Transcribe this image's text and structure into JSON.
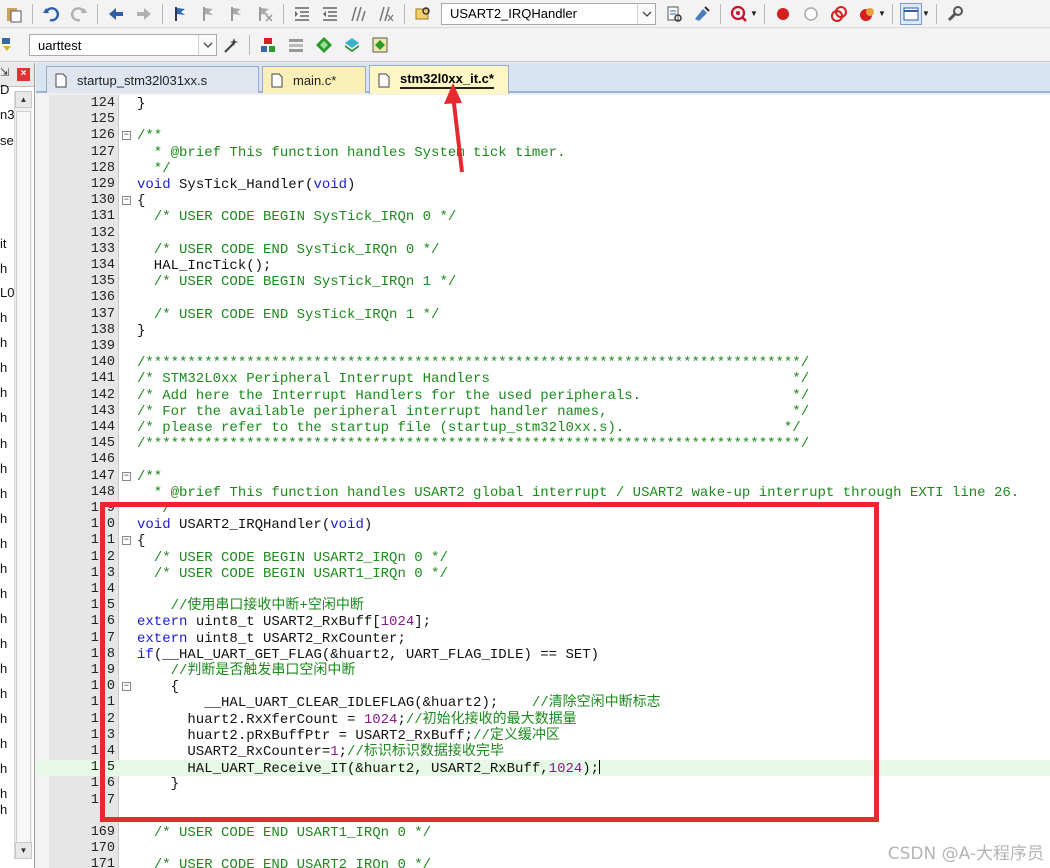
{
  "toolbar_top": {
    "function_combo_value": "USART2_IRQHandler"
  },
  "toolbar_build": {
    "target_combo_value": "uarttest"
  },
  "tabs": [
    {
      "label": "startup_stm32l031xx.s",
      "state": "inactive"
    },
    {
      "label": "main.c*",
      "state": "modified"
    },
    {
      "label": "stm32l0xx_it.c*",
      "state": "active"
    }
  ],
  "left_panel_fragments": [
    "D",
    "n3",
    "se",
    "it",
    "h",
    "L0",
    "h",
    "h",
    "h",
    "h",
    "h",
    "h",
    "h",
    "h",
    "h",
    "h",
    "h",
    "h",
    "h",
    "h",
    "h",
    "h",
    "h",
    "h",
    "h",
    "h",
    "h"
  ],
  "code_lines": [
    {
      "num": "124",
      "fold": "",
      "html": "}"
    },
    {
      "num": "125",
      "fold": "",
      "html": ""
    },
    {
      "num": "126",
      "fold": "-",
      "html": "<span class=\"cm\">/**</span>"
    },
    {
      "num": "127",
      "fold": "",
      "html": "<span class=\"cm\">  * @brief This function handles System tick timer.</span>"
    },
    {
      "num": "128",
      "fold": "",
      "html": "<span class=\"cm\">  */</span>"
    },
    {
      "num": "129",
      "fold": "",
      "html": "<span class=\"kw\">void</span> SysTick_Handler(<span class=\"kw\">void</span>)"
    },
    {
      "num": "130",
      "fold": "-",
      "html": "{"
    },
    {
      "num": "131",
      "fold": "",
      "html": "  <span class=\"cm\">/* USER CODE BEGIN SysTick_IRQn 0 */</span>"
    },
    {
      "num": "132",
      "fold": "",
      "html": ""
    },
    {
      "num": "133",
      "fold": "",
      "html": "  <span class=\"cm\">/* USER CODE END SysTick_IRQn 0 */</span>"
    },
    {
      "num": "134",
      "fold": "",
      "html": "  HAL_IncTick();"
    },
    {
      "num": "135",
      "fold": "",
      "html": "  <span class=\"cm\">/* USER CODE BEGIN SysTick_IRQn 1 */</span>"
    },
    {
      "num": "136",
      "fold": "",
      "html": ""
    },
    {
      "num": "137",
      "fold": "",
      "html": "  <span class=\"cm\">/* USER CODE END SysTick_IRQn 1 */</span>"
    },
    {
      "num": "138",
      "fold": "",
      "html": "}"
    },
    {
      "num": "139",
      "fold": "",
      "html": ""
    },
    {
      "num": "140",
      "fold": "",
      "html": "<span class=\"cm\">/******************************************************************************/</span>"
    },
    {
      "num": "141",
      "fold": "",
      "html": "<span class=\"cm\">/* STM32L0xx Peripheral Interrupt Handlers                                    */</span>"
    },
    {
      "num": "142",
      "fold": "",
      "html": "<span class=\"cm\">/* Add here the Interrupt Handlers for the used peripherals.                  */</span>"
    },
    {
      "num": "143",
      "fold": "",
      "html": "<span class=\"cm\">/* For the available peripheral interrupt handler names,                      */</span>"
    },
    {
      "num": "144",
      "fold": "",
      "html": "<span class=\"cm\">/* please refer to the startup file (startup_stm32l0xx.s).                   */</span>"
    },
    {
      "num": "145",
      "fold": "",
      "html": "<span class=\"cm\">/******************************************************************************/</span>"
    },
    {
      "num": "146",
      "fold": "",
      "html": ""
    },
    {
      "num": "147",
      "fold": "-",
      "html": "<span class=\"cm\">/**</span>"
    },
    {
      "num": "148",
      "fold": "",
      "html": "<span class=\"cm\">  * @brief This function handles USART2 global interrupt / USART2 wake-up interrupt through EXTI line 26.</span>"
    },
    {
      "num": "1  9",
      "fold": "",
      "html": "<span class=\"cm\">  */</span>"
    },
    {
      "num": "1  0",
      "fold": "",
      "html": "<span class=\"kw\">void</span> USART2_IRQHandler(<span class=\"kw\">void</span>)"
    },
    {
      "num": "1  1",
      "fold": "-",
      "html": "{"
    },
    {
      "num": "1  2",
      "fold": "",
      "html": "  <span class=\"cm\">/* USER CODE BEGIN USART2_IRQn 0 */</span>"
    },
    {
      "num": "1  3",
      "fold": "",
      "html": "  <span class=\"cm\">/* USER CODE BEGIN USART1_IRQn 0 */</span>"
    },
    {
      "num": "1  4",
      "fold": "",
      "html": ""
    },
    {
      "num": "1  5",
      "fold": "",
      "html": "    <span class=\"cm\">//使用串口接收中断+空闲中断</span>"
    },
    {
      "num": "1  6",
      "fold": "",
      "html": "<span class=\"kw\">extern</span> uint8_t USART2_RxBuff[<span class=\"num\">1024</span>];"
    },
    {
      "num": "1  7",
      "fold": "",
      "html": "<span class=\"kw\">extern</span> uint8_t USART2_RxCounter;"
    },
    {
      "num": "1  8",
      "fold": "",
      "html": "<span class=\"kw\">if</span>(__HAL_UART_GET_FLAG(&amp;huart2, UART_FLAG_IDLE) == SET)"
    },
    {
      "num": "1  9",
      "fold": "",
      "html": "    <span class=\"cm\">//判断是否触发串口空闲中断</span>"
    },
    {
      "num": "1  0",
      "fold": "-",
      "html": "    {"
    },
    {
      "num": "1  1",
      "fold": "",
      "html": "        __HAL_UART_CLEAR_IDLEFLAG(&amp;huart2);    <span class=\"cm\">//清除空闲中断标志</span>"
    },
    {
      "num": "1  2",
      "fold": "",
      "html": "      huart2.RxXferCount = <span class=\"num\">1024</span>;<span class=\"cm\">//初始化接收的最大数据量</span>"
    },
    {
      "num": "1  3",
      "fold": "",
      "html": "      huart2.pRxBuffPtr = USART2_RxBuff;<span class=\"cm\">//定义缓冲区</span>"
    },
    {
      "num": "1  4",
      "fold": "",
      "html": "      USART2_RxCounter=<span class=\"num\">1</span>;<span class=\"cm\">//标识标识数据接收完毕</span>"
    },
    {
      "num": "1  5",
      "fold": "",
      "html": "      HAL_UART_Receive_IT(&amp;huart2, USART2_RxBuff,<span class=\"num\">1024</span>);<span class=\"caret\"></span>",
      "current": true
    },
    {
      "num": "1  6",
      "fold": "",
      "html": "    }"
    },
    {
      "num": "1  7",
      "fold": "",
      "html": ""
    },
    {
      "num": "",
      "fold": "",
      "html": ""
    },
    {
      "num": "169",
      "fold": "",
      "html": "  <span class=\"cm\">/* USER CODE END USART1_IRQn 0 */</span>"
    },
    {
      "num": "170",
      "fold": "",
      "html": ""
    },
    {
      "num": "171",
      "fold": "",
      "html": "  <span class=\"cm\">/* USER CODE END USART2_IRQn 0 */</span>"
    }
  ],
  "watermark": "CSDN @A-大程序员",
  "colors": {
    "highlight": "#e5292f",
    "keyword": "#1d1dcd",
    "comment": "#1c8a1c"
  }
}
